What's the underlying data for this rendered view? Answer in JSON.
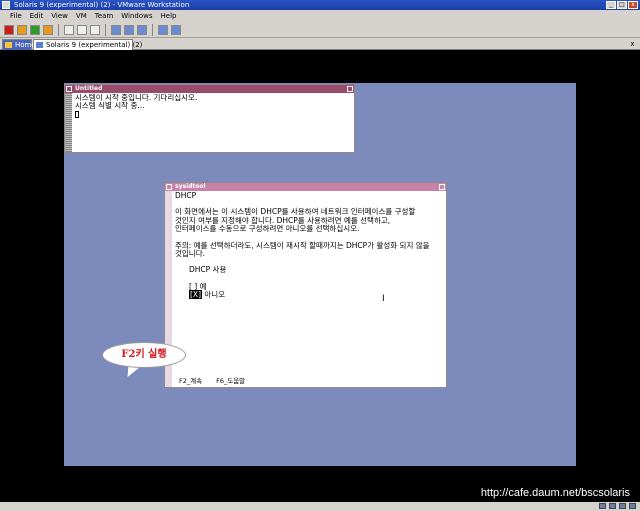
{
  "window": {
    "title": "Solaris 9 (experimental) (2) - VMware Workstation",
    "buttons": [
      "_",
      "□",
      "x"
    ]
  },
  "menubar": [
    "File",
    "Edit",
    "View",
    "VM",
    "Team",
    "Windows",
    "Help"
  ],
  "tabs": [
    {
      "label": "Home"
    },
    {
      "label": "Solaris 9 (experimental) (2)"
    }
  ],
  "tab_close": "x",
  "guest": {
    "untitled": {
      "title": "Untitled",
      "lines": [
        "시스템이 시작 중입니다. 기다리십시오.",
        "시스템 식별 시작 중..."
      ]
    },
    "sysidtool": {
      "title": "sysidtool",
      "heading": "DHCP",
      "para1": [
        "이 화면에서는 이 시스템이 DHCP를 사용하여 네트워크 인터페이스를 구성할",
        "것인지 여부를 지정해야 합니다.  DHCP를 사용하려면 예를 선택하고,",
        "인터페이스를 수동으로 구성하려면 아니오를 선택하십시오."
      ],
      "para2": [
        "주의: 예를 선택하더라도, 시스템이 재시작 할때까지는 DHCP가 활성화 되지 않을",
        "것입니다."
      ],
      "option_label": "DHCP 사용",
      "option_yes_mark": "[ ]",
      "option_yes": "예",
      "option_no_mark": "[X]",
      "option_no": "아니오",
      "key_continue": "F2_계속",
      "key_help": "F6_도움말"
    }
  },
  "annotation": {
    "text": "F2키 실행",
    "color": "#d0161a"
  },
  "watermark": "http://cafe.daum.net/bscsolaris",
  "colors": {
    "desktop": "#7c8bbc",
    "untitled_title": "#9a4a6c",
    "sysidtool_title": "#c882a8"
  }
}
